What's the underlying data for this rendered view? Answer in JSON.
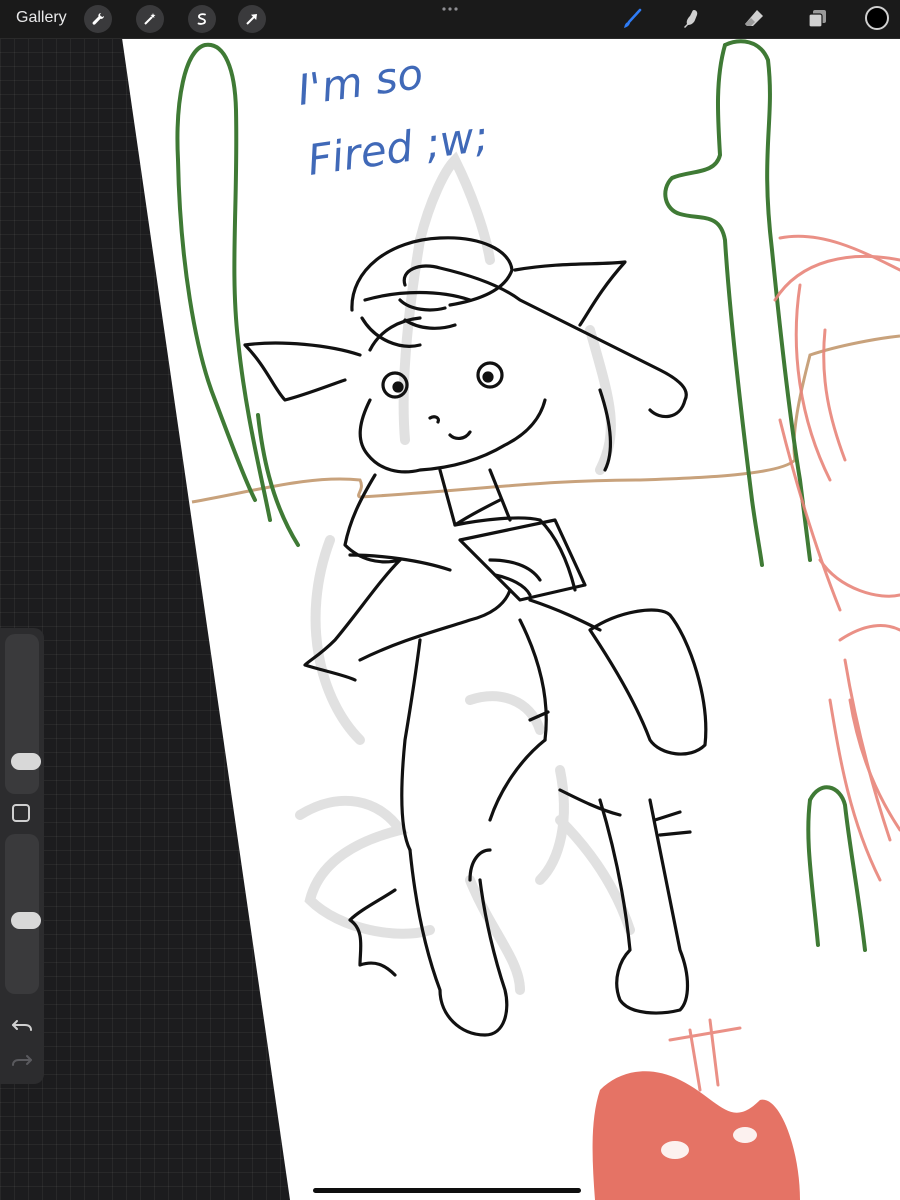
{
  "toolbar": {
    "gallery_label": "Gallery",
    "left_tools": [
      {
        "name": "actions",
        "icon": "wrench-icon"
      },
      {
        "name": "adjustments",
        "icon": "magic-wand-icon"
      },
      {
        "name": "selection",
        "icon": "selection-s-icon"
      },
      {
        "name": "transform",
        "icon": "arrow-cursor-icon"
      }
    ],
    "right_tools": [
      {
        "name": "brush",
        "icon": "brush-icon",
        "active": true
      },
      {
        "name": "smudge",
        "icon": "smudge-finger-icon"
      },
      {
        "name": "eraser",
        "icon": "eraser-icon"
      },
      {
        "name": "layers",
        "icon": "layers-icon"
      }
    ],
    "color": "#000000",
    "accent": "#2f7cf6"
  },
  "canvas": {
    "text": [
      "I'm so",
      "Fired ;w;"
    ]
  },
  "sidebar": {
    "size_level": 0.15,
    "opacity_level": 0.45
  }
}
